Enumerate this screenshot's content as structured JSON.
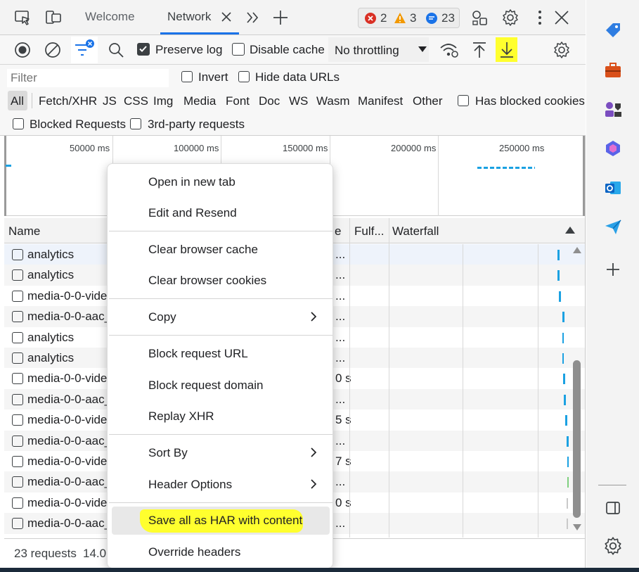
{
  "tabs": {
    "welcome": "Welcome",
    "network": "Network",
    "errors": "2",
    "warnings": "3",
    "messages": "23"
  },
  "toolbar": {
    "preserve_log": "Preserve log",
    "disable_cache": "Disable cache",
    "throttling": "No throttling"
  },
  "filters": {
    "placeholder": "Filter",
    "invert": "Invert",
    "hide_data_urls": "Hide data URLs",
    "types": [
      "All",
      "Fetch/XHR",
      "JS",
      "CSS",
      "Img",
      "Media",
      "Font",
      "Doc",
      "WS",
      "Wasm",
      "Manifest",
      "Other"
    ],
    "has_blocked_cookies": "Has blocked cookies",
    "blocked_requests": "Blocked Requests",
    "third_party": "3rd-party requests"
  },
  "overview": {
    "ticks": [
      "50000 ms",
      "100000 ms",
      "150000 ms",
      "200000 ms",
      "250000 ms"
    ]
  },
  "table": {
    "headers": {
      "name": "Name",
      "type_partial": "e",
      "fulfilled": "Fulf...",
      "waterfall": "Waterfall"
    },
    "rows": [
      {
        "name": "analytics",
        "tail": "..."
      },
      {
        "name": "analytics",
        "tail": "..."
      },
      {
        "name": "media-0-0-vide",
        "tail": "..."
      },
      {
        "name": "media-0-0-aac_",
        "tail": "..."
      },
      {
        "name": "analytics",
        "tail": "..."
      },
      {
        "name": "analytics",
        "tail": "..."
      },
      {
        "name": "media-0-0-vide",
        "tail": "0 s"
      },
      {
        "name": "media-0-0-aac_",
        "tail": "..."
      },
      {
        "name": "media-0-0-vide",
        "tail": "5 s"
      },
      {
        "name": "media-0-0-aac_",
        "tail": "..."
      },
      {
        "name": "media-0-0-vide",
        "tail": "7 s"
      },
      {
        "name": "media-0-0-aac_",
        "tail": "..."
      },
      {
        "name": "media-0-0-vide",
        "tail": "0 s"
      },
      {
        "name": "media-0-0-aac_",
        "tail": "..."
      }
    ]
  },
  "status": {
    "requests": "23 requests",
    "transferred": "14.0"
  },
  "menu": {
    "open_new_tab": "Open in new tab",
    "edit_resend": "Edit and Resend",
    "clear_cache": "Clear browser cache",
    "clear_cookies": "Clear browser cookies",
    "copy": "Copy",
    "block_url": "Block request URL",
    "block_domain": "Block request domain",
    "replay_xhr": "Replay XHR",
    "sort_by": "Sort By",
    "header_options": "Header Options",
    "save_har": "Save all as HAR with content",
    "override_headers": "Override headers"
  },
  "colors": {
    "accent": "#1a73e8",
    "highlight": "#ffff2e",
    "waterfall_bar": "#1ba1e2",
    "error": "#d93025",
    "warning": "#f29900"
  }
}
